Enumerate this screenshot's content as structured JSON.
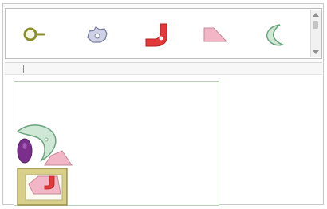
{
  "palette": {
    "items": [
      {
        "name": "circle-key",
        "fill": "#f6f6e6",
        "stroke": "#8a8f2a"
      },
      {
        "name": "gear-blob",
        "fill": "#cfd2e6",
        "stroke": "#7a7fa0"
      },
      {
        "name": "hook",
        "fill": "#e23a3a",
        "stroke": "#b81f1f"
      },
      {
        "name": "wedge",
        "fill": "#f2b6c6",
        "stroke": "#c48898"
      },
      {
        "name": "crescent",
        "fill": "#cfe8d6",
        "stroke": "#6aa37d"
      }
    ]
  },
  "canvas": {
    "border_color": "#b7d3b3",
    "pieces": [
      {
        "name": "crescent-piece",
        "fill": "#cfe8d6",
        "stroke": "#6aa37d"
      },
      {
        "name": "purple-oval-piece",
        "fill": "#7a2f8c",
        "stroke": "#5a1f6a"
      },
      {
        "name": "pink-wedge-piece",
        "fill": "#f2b6c6",
        "stroke": "#c48898"
      },
      {
        "name": "olive-box-piece",
        "fill": "#d8cf8a",
        "stroke": "#8a8032"
      },
      {
        "name": "pink-inner-piece",
        "fill": "#f2b6c6",
        "stroke": "#c48898"
      },
      {
        "name": "red-hook-piece",
        "fill": "#e23a3a",
        "stroke": "#b81f1f"
      }
    ]
  }
}
